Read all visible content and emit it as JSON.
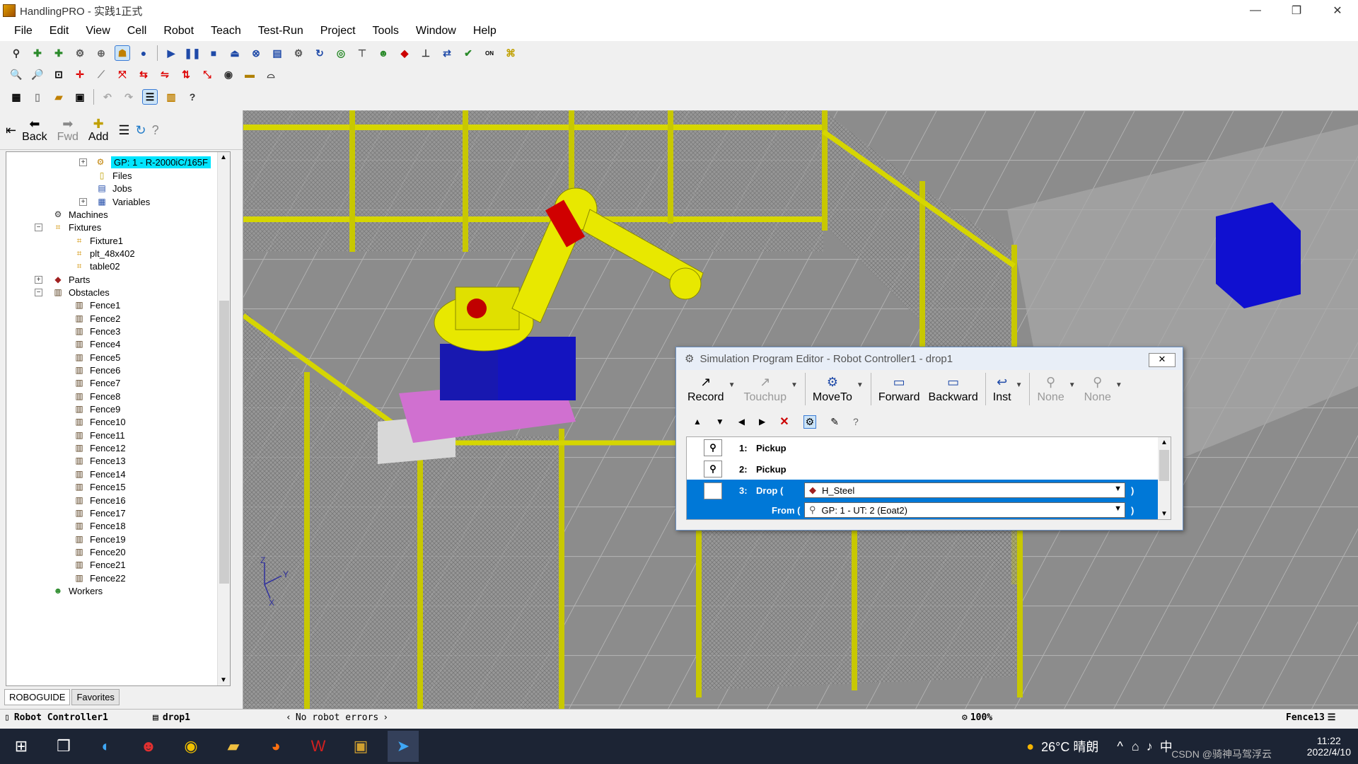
{
  "window": {
    "title": "HandlingPRO - 实践1正式",
    "min": "—",
    "max": "❐",
    "close": "✕"
  },
  "menu": [
    "File",
    "Edit",
    "View",
    "Cell",
    "Robot",
    "Teach",
    "Test-Run",
    "Project",
    "Tools",
    "Window",
    "Help"
  ],
  "left_toolbar": {
    "back": "Back",
    "fwd": "Fwd",
    "add": "Add"
  },
  "tree": {
    "gp": "GP: 1 - R-2000iC/165F",
    "files": "Files",
    "jobs": "Jobs",
    "variables": "Variables",
    "machines": "Machines",
    "fixtures": "Fixtures",
    "fixture_items": [
      "Fixture1",
      "plt_48x402",
      "table02"
    ],
    "parts": "Parts",
    "obstacles": "Obstacles",
    "fences": [
      "Fence1",
      "Fence2",
      "Fence3",
      "Fence4",
      "Fence5",
      "Fence6",
      "Fence7",
      "Fence8",
      "Fence9",
      "Fence10",
      "Fence11",
      "Fence12",
      "Fence13",
      "Fence14",
      "Fence15",
      "Fence16",
      "Fence17",
      "Fence18",
      "Fence19",
      "Fence20",
      "Fence21",
      "Fence22"
    ],
    "workers": "Workers"
  },
  "left_tabs": {
    "roboguide": "ROBOGUIDE",
    "favorites": "Favorites"
  },
  "dialog": {
    "title": "Simulation Program Editor - Robot Controller1 - drop1",
    "close": "✕",
    "buttons": {
      "record": "Record",
      "touchup": "Touchup",
      "moveto": "MoveTo",
      "forward": "Forward",
      "backward": "Backward",
      "inst": "Inst",
      "none1": "None",
      "none2": "None"
    },
    "lines": [
      {
        "num": "1:",
        "text": "Pickup"
      },
      {
        "num": "2:",
        "text": "Pickup"
      },
      {
        "num": "3:",
        "text": "Drop (",
        "part": "H_Steel",
        "close": ")"
      }
    ],
    "from_label": "From (",
    "from_value": "GP: 1 - UT: 2  (Eoat2)",
    "from_close": ")"
  },
  "status": {
    "controller": "Robot Controller1",
    "program": "drop1",
    "errors": "No robot errors",
    "zoom": "100%",
    "selected": "Fence13"
  },
  "tray": {
    "weather": "26°C  晴朗",
    "ime": "中",
    "time": "11:22",
    "date": "2022/4/10",
    "watermark": "CSDN @骑神马驾浮云"
  },
  "axes": {
    "z": "Z",
    "y": "Y",
    "x": "X"
  }
}
